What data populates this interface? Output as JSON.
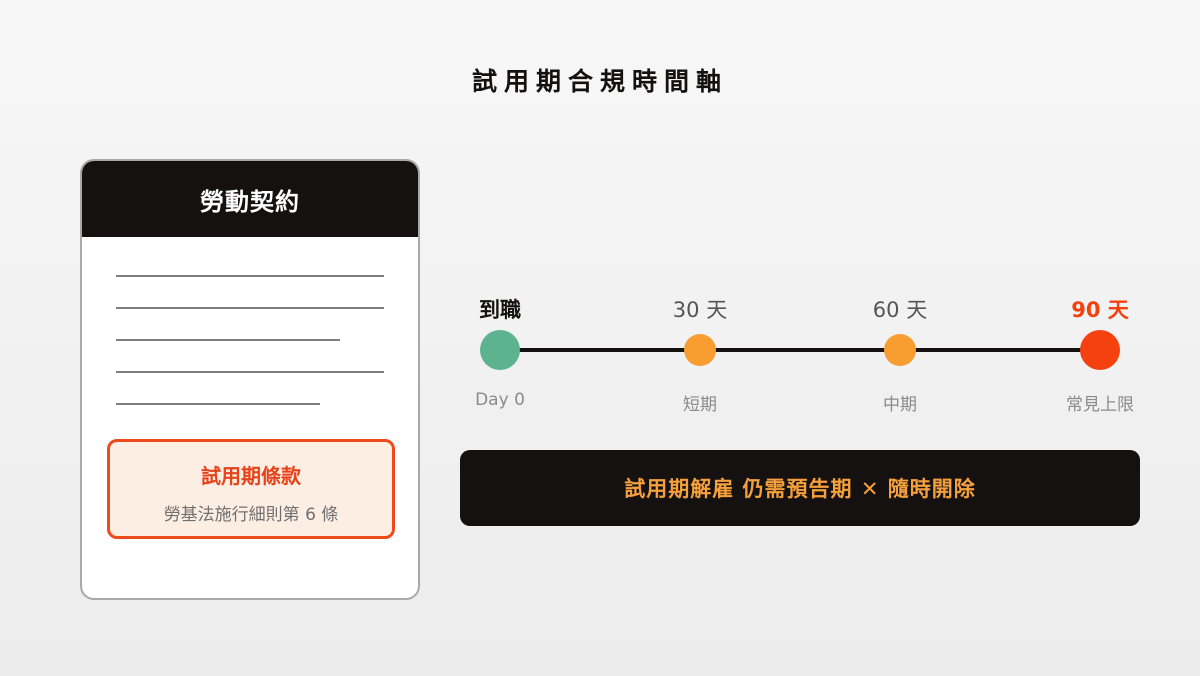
{
  "title": "試用期合規時間軸",
  "contract": {
    "header": "勞動契約",
    "clause_title": "試用期條款",
    "clause_ref": "勞基法施行細則第 6 條"
  },
  "timeline": {
    "points": [
      {
        "top_label": "到職",
        "bottom_label": "Day 0",
        "color": "#5db38f"
      },
      {
        "top_label": "30 天",
        "bottom_label": "短期",
        "color": "#f89d2f"
      },
      {
        "top_label": "60 天",
        "bottom_label": "中期",
        "color": "#f89d2f"
      },
      {
        "top_label": "90 天",
        "bottom_label": "常見上限",
        "color": "#f5410f"
      }
    ]
  },
  "banner": "試用期解雇 仍需預告期 ✕ 隨時開除",
  "colors": {
    "dark": "#141110",
    "accent_red": "#ee4b1c",
    "accent_orange": "#f5a03c",
    "start_green": "#5db38f"
  }
}
